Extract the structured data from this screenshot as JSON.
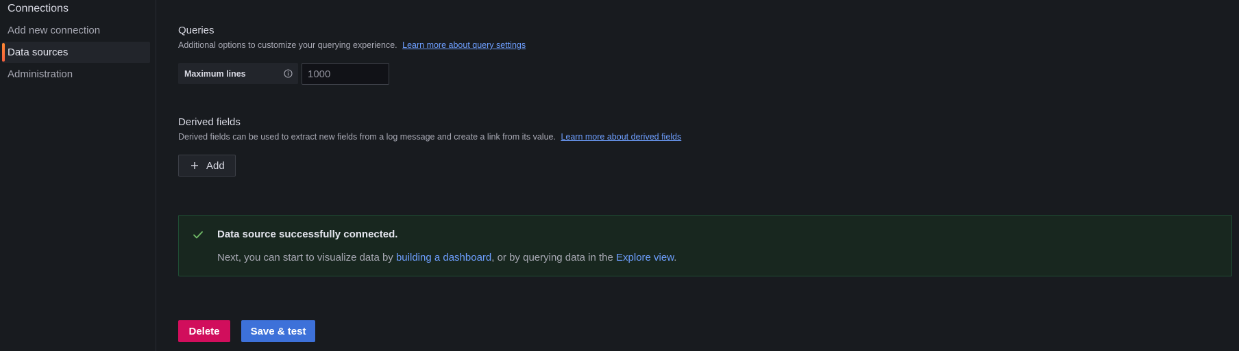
{
  "sidebar": {
    "heading": "Connections",
    "items": [
      {
        "label": "Add new connection",
        "active": false
      },
      {
        "label": "Data sources",
        "active": true
      },
      {
        "label": "Administration",
        "active": false
      }
    ]
  },
  "queries": {
    "title": "Queries",
    "description": "Additional options to customize your querying experience.",
    "link": "Learn more about query settings",
    "max_lines_label": "Maximum lines",
    "max_lines_placeholder": "1000"
  },
  "derived_fields": {
    "title": "Derived fields",
    "description": "Derived fields can be used to extract new fields from a log message and create a link from its value.",
    "link": "Learn more about derived fields",
    "add_label": "Add"
  },
  "alert": {
    "title": "Data source successfully connected.",
    "body_prefix": "Next, you can start to visualize data by ",
    "dashboard_link": "building a dashboard",
    "body_middle": ", or by querying data in the ",
    "explore_link": "Explore view",
    "body_suffix": ".",
    "color": "#73bf69"
  },
  "actions": {
    "delete_label": "Delete",
    "save_label": "Save & test"
  },
  "colors": {
    "delete": "#d10e5c",
    "save": "#3d71d9",
    "link": "#6e9fff",
    "active_indicator": "#f55f3e"
  }
}
